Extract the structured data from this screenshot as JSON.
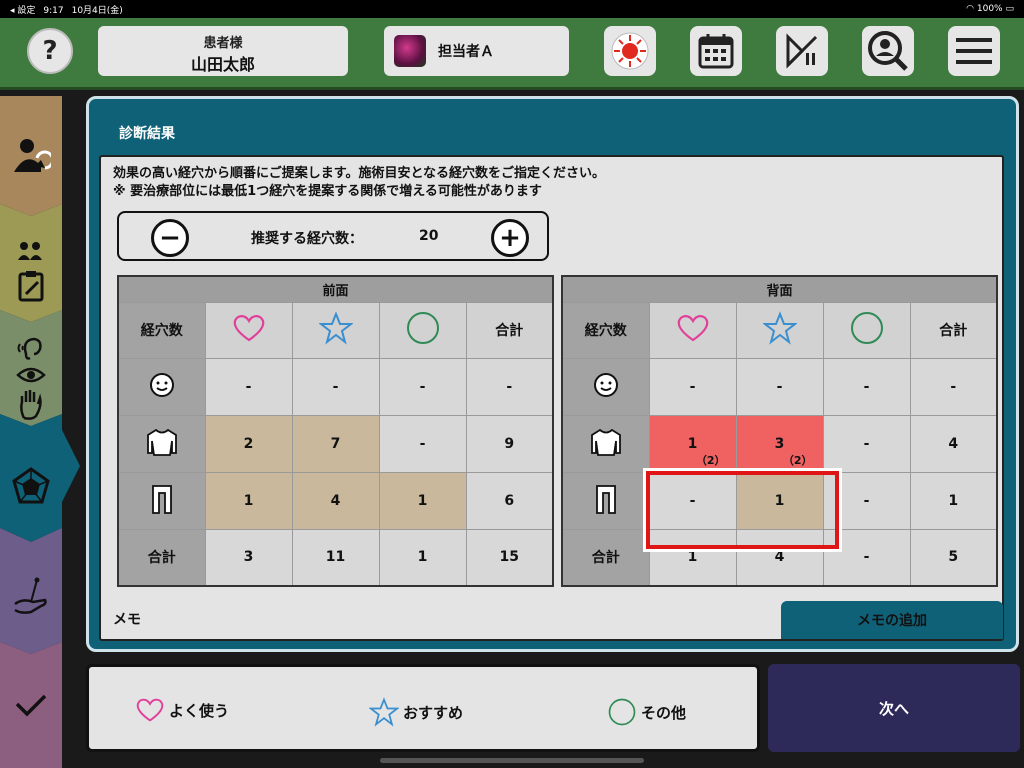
{
  "status": {
    "left_label": "◂ 設定",
    "time": "9:17",
    "date": "10月4日(金)",
    "battery": "100%"
  },
  "header": {
    "help": "?",
    "patient_title": "患者様",
    "patient_name": "山田太郎",
    "staff_name": "担当者Ａ"
  },
  "main": {
    "title": "診断結果",
    "desc1": "効果の高い経穴から順番にご提案します。施術目安となる経穴数をご指定ください。",
    "desc2": "※ 要治療部位には最低1つ経穴を提案する関係で増える可能性があります",
    "stepper": {
      "label": "推奨する経穴数：",
      "value": "20",
      "minus": "−",
      "plus": "+"
    },
    "memo_label": "メモ",
    "memo_add": "メモの追加"
  },
  "front": {
    "caption": "前面",
    "col0": "経穴数",
    "total": "合計",
    "rows": [
      [
        "-",
        "-",
        "-",
        "-"
      ],
      [
        "2",
        "7",
        "-",
        "9"
      ],
      [
        "1",
        "4",
        "1",
        "6"
      ],
      [
        "3",
        "11",
        "1",
        "15"
      ]
    ]
  },
  "back": {
    "caption": "背面",
    "col0": "経穴数",
    "total": "合計",
    "rows": [
      [
        "-",
        "-",
        "-",
        "-"
      ],
      [
        "1",
        "3",
        "-",
        "4"
      ],
      [
        "-",
        "1",
        "-",
        "1"
      ],
      [
        "1",
        "4",
        "-",
        "5"
      ]
    ],
    "sub": {
      "r1c0": "（2）",
      "r1c1": "（2）"
    }
  },
  "legend": {
    "fav": "よく使う",
    "rec": "おすすめ",
    "other": "その他"
  },
  "next": "次へ",
  "colors": {
    "header": "#3f7a3e",
    "panel": "#0f6178",
    "heart": "#e0409a",
    "star": "#3a8fd0",
    "circle": "#2f8a55",
    "tan": "#c9b89c",
    "red": "#f06262",
    "next": "#2d2a5a"
  }
}
